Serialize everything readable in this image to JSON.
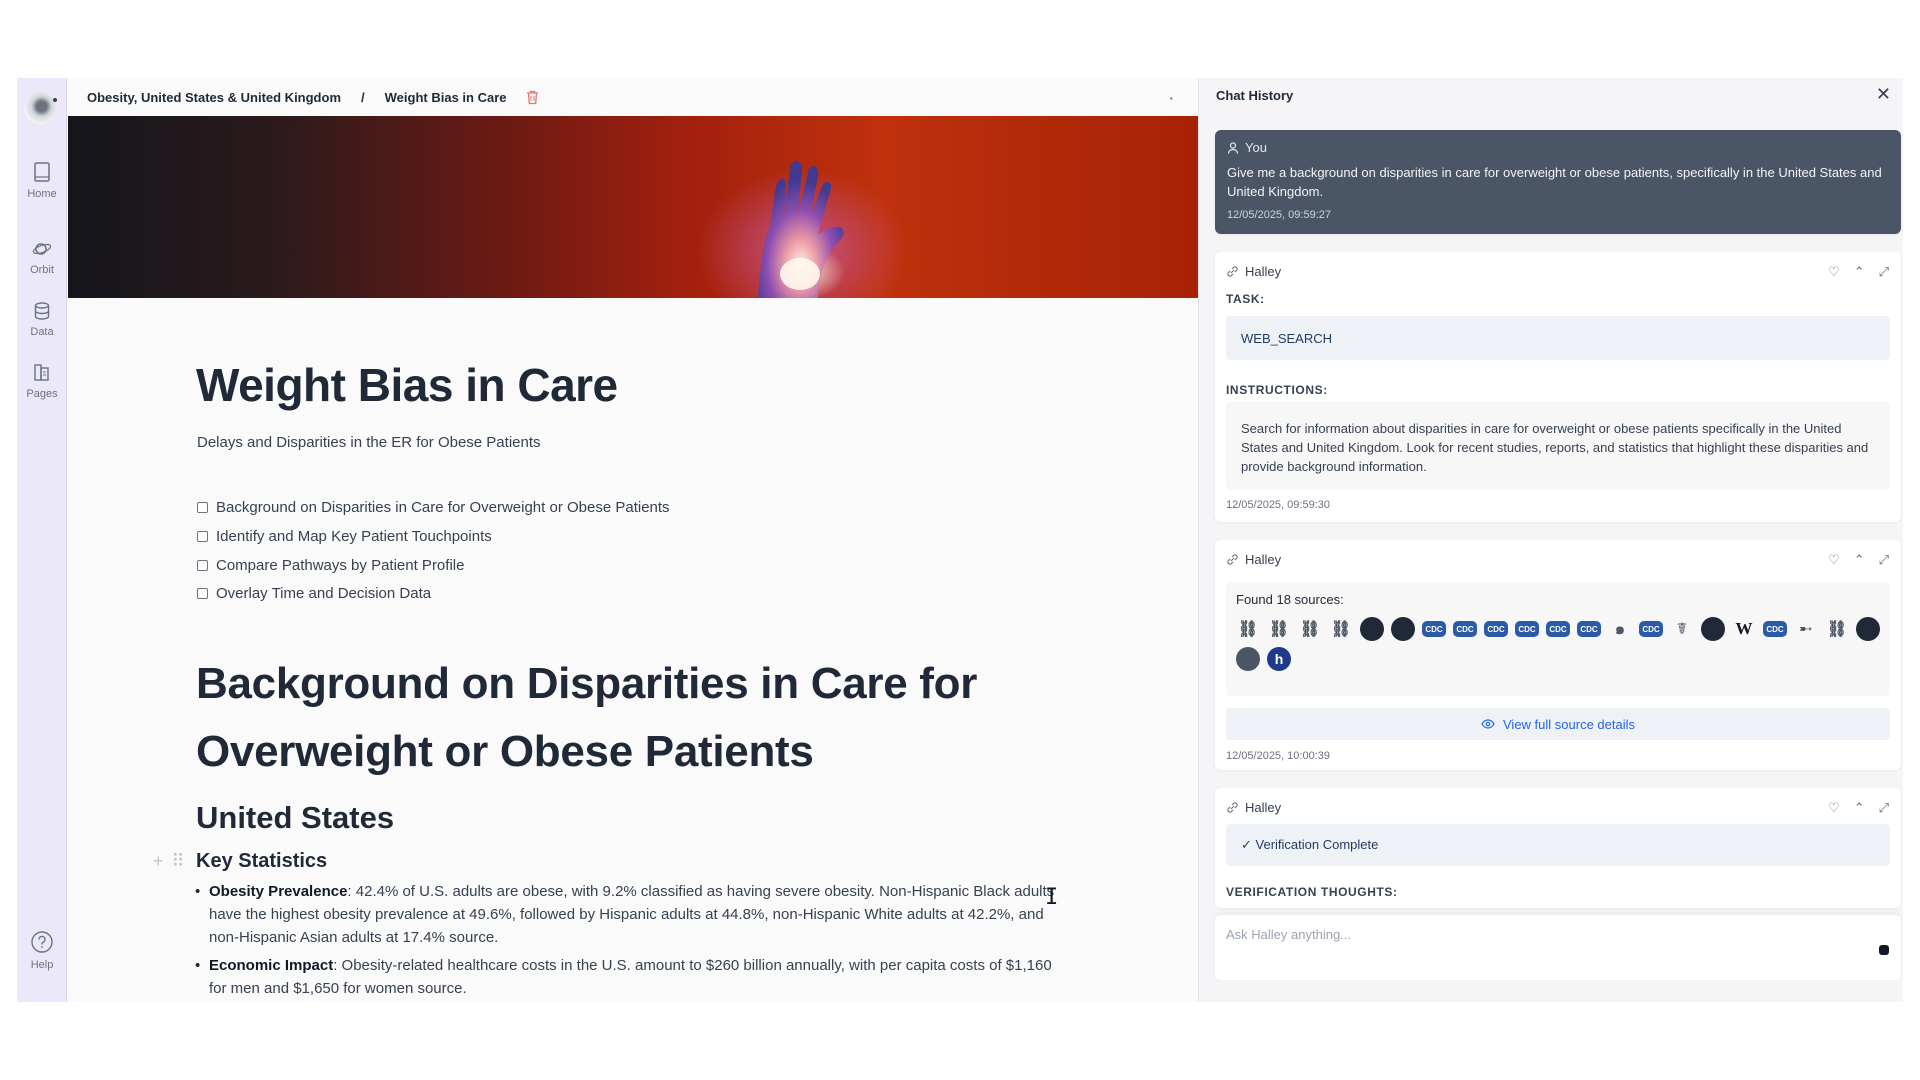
{
  "breadcrumb": {
    "parent": "Obesity, United States & United Kingdom",
    "separator": "/",
    "current": "Weight Bias in Care"
  },
  "nav": [
    {
      "label": "Home"
    },
    {
      "label": "Orbit"
    },
    {
      "label": "Data"
    },
    {
      "label": "Pages"
    }
  ],
  "nav_help": "Help",
  "page": {
    "title": "Weight Bias in Care",
    "subtitle": "Delays and Disparities in the ER for Obese Patients",
    "todos": [
      "Background on Disparities in Care for Overweight or Obese Patients",
      "Identify and Map Key Patient Touchpoints",
      "Compare Pathways by Patient Profile",
      "Overlay Time and Decision Data"
    ],
    "h1": "Background on Disparities in Care for Overweight or Obese Patients",
    "h2": "United States",
    "h3": "Key Statistics",
    "bullets": [
      {
        "term": "Obesity Prevalence",
        "text": ": 42.4% of U.S. adults are obese, with 9.2% classified as having severe obesity. Non-Hispanic Black adults have the highest obesity prevalence at 49.6%, followed by Hispanic adults at 44.8%, non-Hispanic White adults at 42.2%, and non-Hispanic Asian adults at 17.4% source."
      },
      {
        "term": "Economic Impact",
        "text": ": Obesity-related healthcare costs in the U.S. amount to $260 billion annually, with per capita costs of $1,160 for men and $1,650 for women source."
      }
    ]
  },
  "chat": {
    "title": "Chat History",
    "close": "✕",
    "user_message": {
      "author": "You",
      "text": "Give me a background on disparities in care for overweight or obese patients, specifically in the United States and United Kingdom.",
      "timestamp": "12/05/2025, 09:59:27"
    },
    "task_card": {
      "author": "Halley",
      "task_label": "TASK:",
      "task_value": "WEB_SEARCH",
      "instructions_label": "INSTRUCTIONS:",
      "instructions": "Search for information about disparities in care for overweight or obese patients specifically in the United States and United Kingdom. Look for recent studies, reports, and statistics that highlight these disparities and provide background information.",
      "timestamp": "12/05/2025, 09:59:30"
    },
    "sources_card": {
      "author": "Halley",
      "found": "Found 18 sources:",
      "sources": [
        {
          "icon": "link-icon"
        },
        {
          "icon": "link-icon"
        },
        {
          "icon": "link-icon"
        },
        {
          "icon": "link-icon"
        },
        {
          "icon": "dark-half-icon"
        },
        {
          "icon": "dark-circle-icon"
        },
        {
          "icon": "cdc-icon",
          "label": "CDC"
        },
        {
          "icon": "cdc-icon",
          "label": "CDC"
        },
        {
          "icon": "cdc-icon",
          "label": "CDC"
        },
        {
          "icon": "cdc-icon",
          "label": "CDC"
        },
        {
          "icon": "cdc-icon",
          "label": "CDC"
        },
        {
          "icon": "cdc-icon",
          "label": "CDC"
        },
        {
          "icon": "swirl-icon"
        },
        {
          "icon": "cdc-icon",
          "label": "CDC"
        },
        {
          "icon": "caduceus-icon"
        },
        {
          "icon": "dark-half-icon"
        },
        {
          "icon": "wikipedia-icon",
          "label": "W"
        },
        {
          "icon": "cdc-icon",
          "label": "CDC"
        },
        {
          "icon": "arrow-icon"
        },
        {
          "icon": "link-icon"
        },
        {
          "icon": "dark-half-icon"
        },
        {
          "icon": "grey-half-icon"
        },
        {
          "icon": "h-icon",
          "label": "h"
        }
      ],
      "view_details": "View full source details",
      "timestamp": "12/05/2025, 10:00:39"
    },
    "verify_card": {
      "author": "Halley",
      "status": "✓ Verification Complete",
      "thoughts_label": "VERIFICATION THOUGHTS:"
    },
    "input_placeholder": "Ask Halley anything..."
  },
  "colors": {
    "sidebar": "#ebe8fa",
    "user_bubble": "#4a5566",
    "accent": "#2563eb"
  }
}
